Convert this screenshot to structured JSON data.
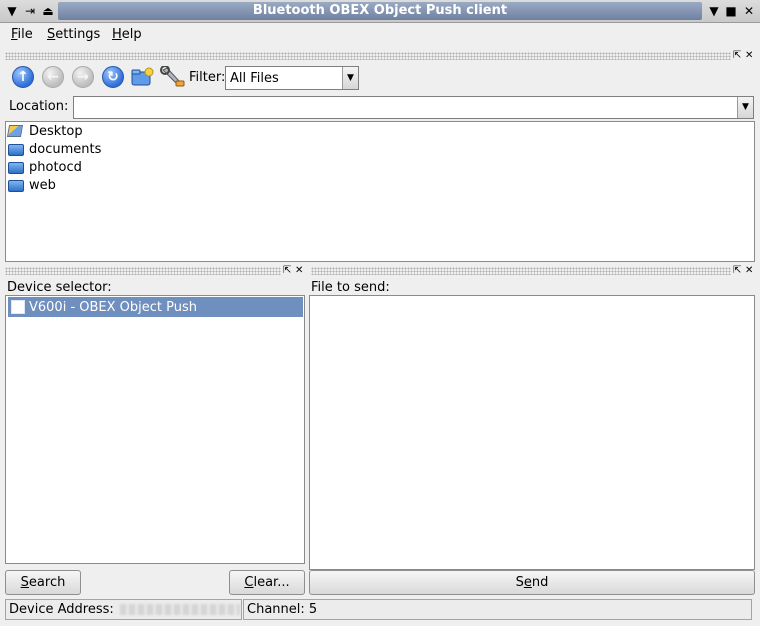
{
  "window": {
    "title": "Bluetooth OBEX Object Push client",
    "left_buttons": [
      "▼",
      "⇥",
      "⏏"
    ],
    "right_buttons": [
      "▼",
      "■",
      "✕"
    ]
  },
  "menu": [
    {
      "label": "File",
      "mnemonic": "F",
      "rest": "ile"
    },
    {
      "label": "Settings",
      "mnemonic": "S",
      "rest": "ettings"
    },
    {
      "label": "Help",
      "mnemonic": "H",
      "rest": "elp"
    }
  ],
  "toolbar": {
    "icons": [
      "up-arrow-icon",
      "back-arrow-icon",
      "forward-arrow-icon",
      "reload-icon",
      "new-folder-icon",
      "settings-wrench-icon"
    ],
    "filter_label": "Filter:",
    "filter_value": "All Files"
  },
  "location": {
    "label": "Location:",
    "value": ""
  },
  "files": [
    {
      "name": "Desktop",
      "icon": "desktop-icon"
    },
    {
      "name": "documents",
      "icon": "folder-icon"
    },
    {
      "name": "photocd",
      "icon": "folder-icon"
    },
    {
      "name": "web",
      "icon": "folder-icon"
    }
  ],
  "device_panel": {
    "label": "Device selector:",
    "devices": [
      {
        "name": "V600i - OBEX Object Push",
        "selected": true,
        "icon": "phone-icon"
      }
    ],
    "search_button": {
      "mnemonic": "S",
      "rest": "earch"
    },
    "clear_button": {
      "mnemonic": "C",
      "rest": "lear..."
    }
  },
  "send_panel": {
    "label": "File to send:",
    "send_button": {
      "pre": "S",
      "mnemonic": "e",
      "rest": "nd"
    }
  },
  "status": {
    "address_label": "Device Address:",
    "channel_text": "Channel: 5"
  },
  "dock_icons": {
    "float": "⇱",
    "close": "✕"
  },
  "colors": {
    "title_strip": "#6f81a2",
    "selection": "#6f8fbe",
    "window_bg": "#efefef",
    "active_icon": "#2f6fd8"
  }
}
